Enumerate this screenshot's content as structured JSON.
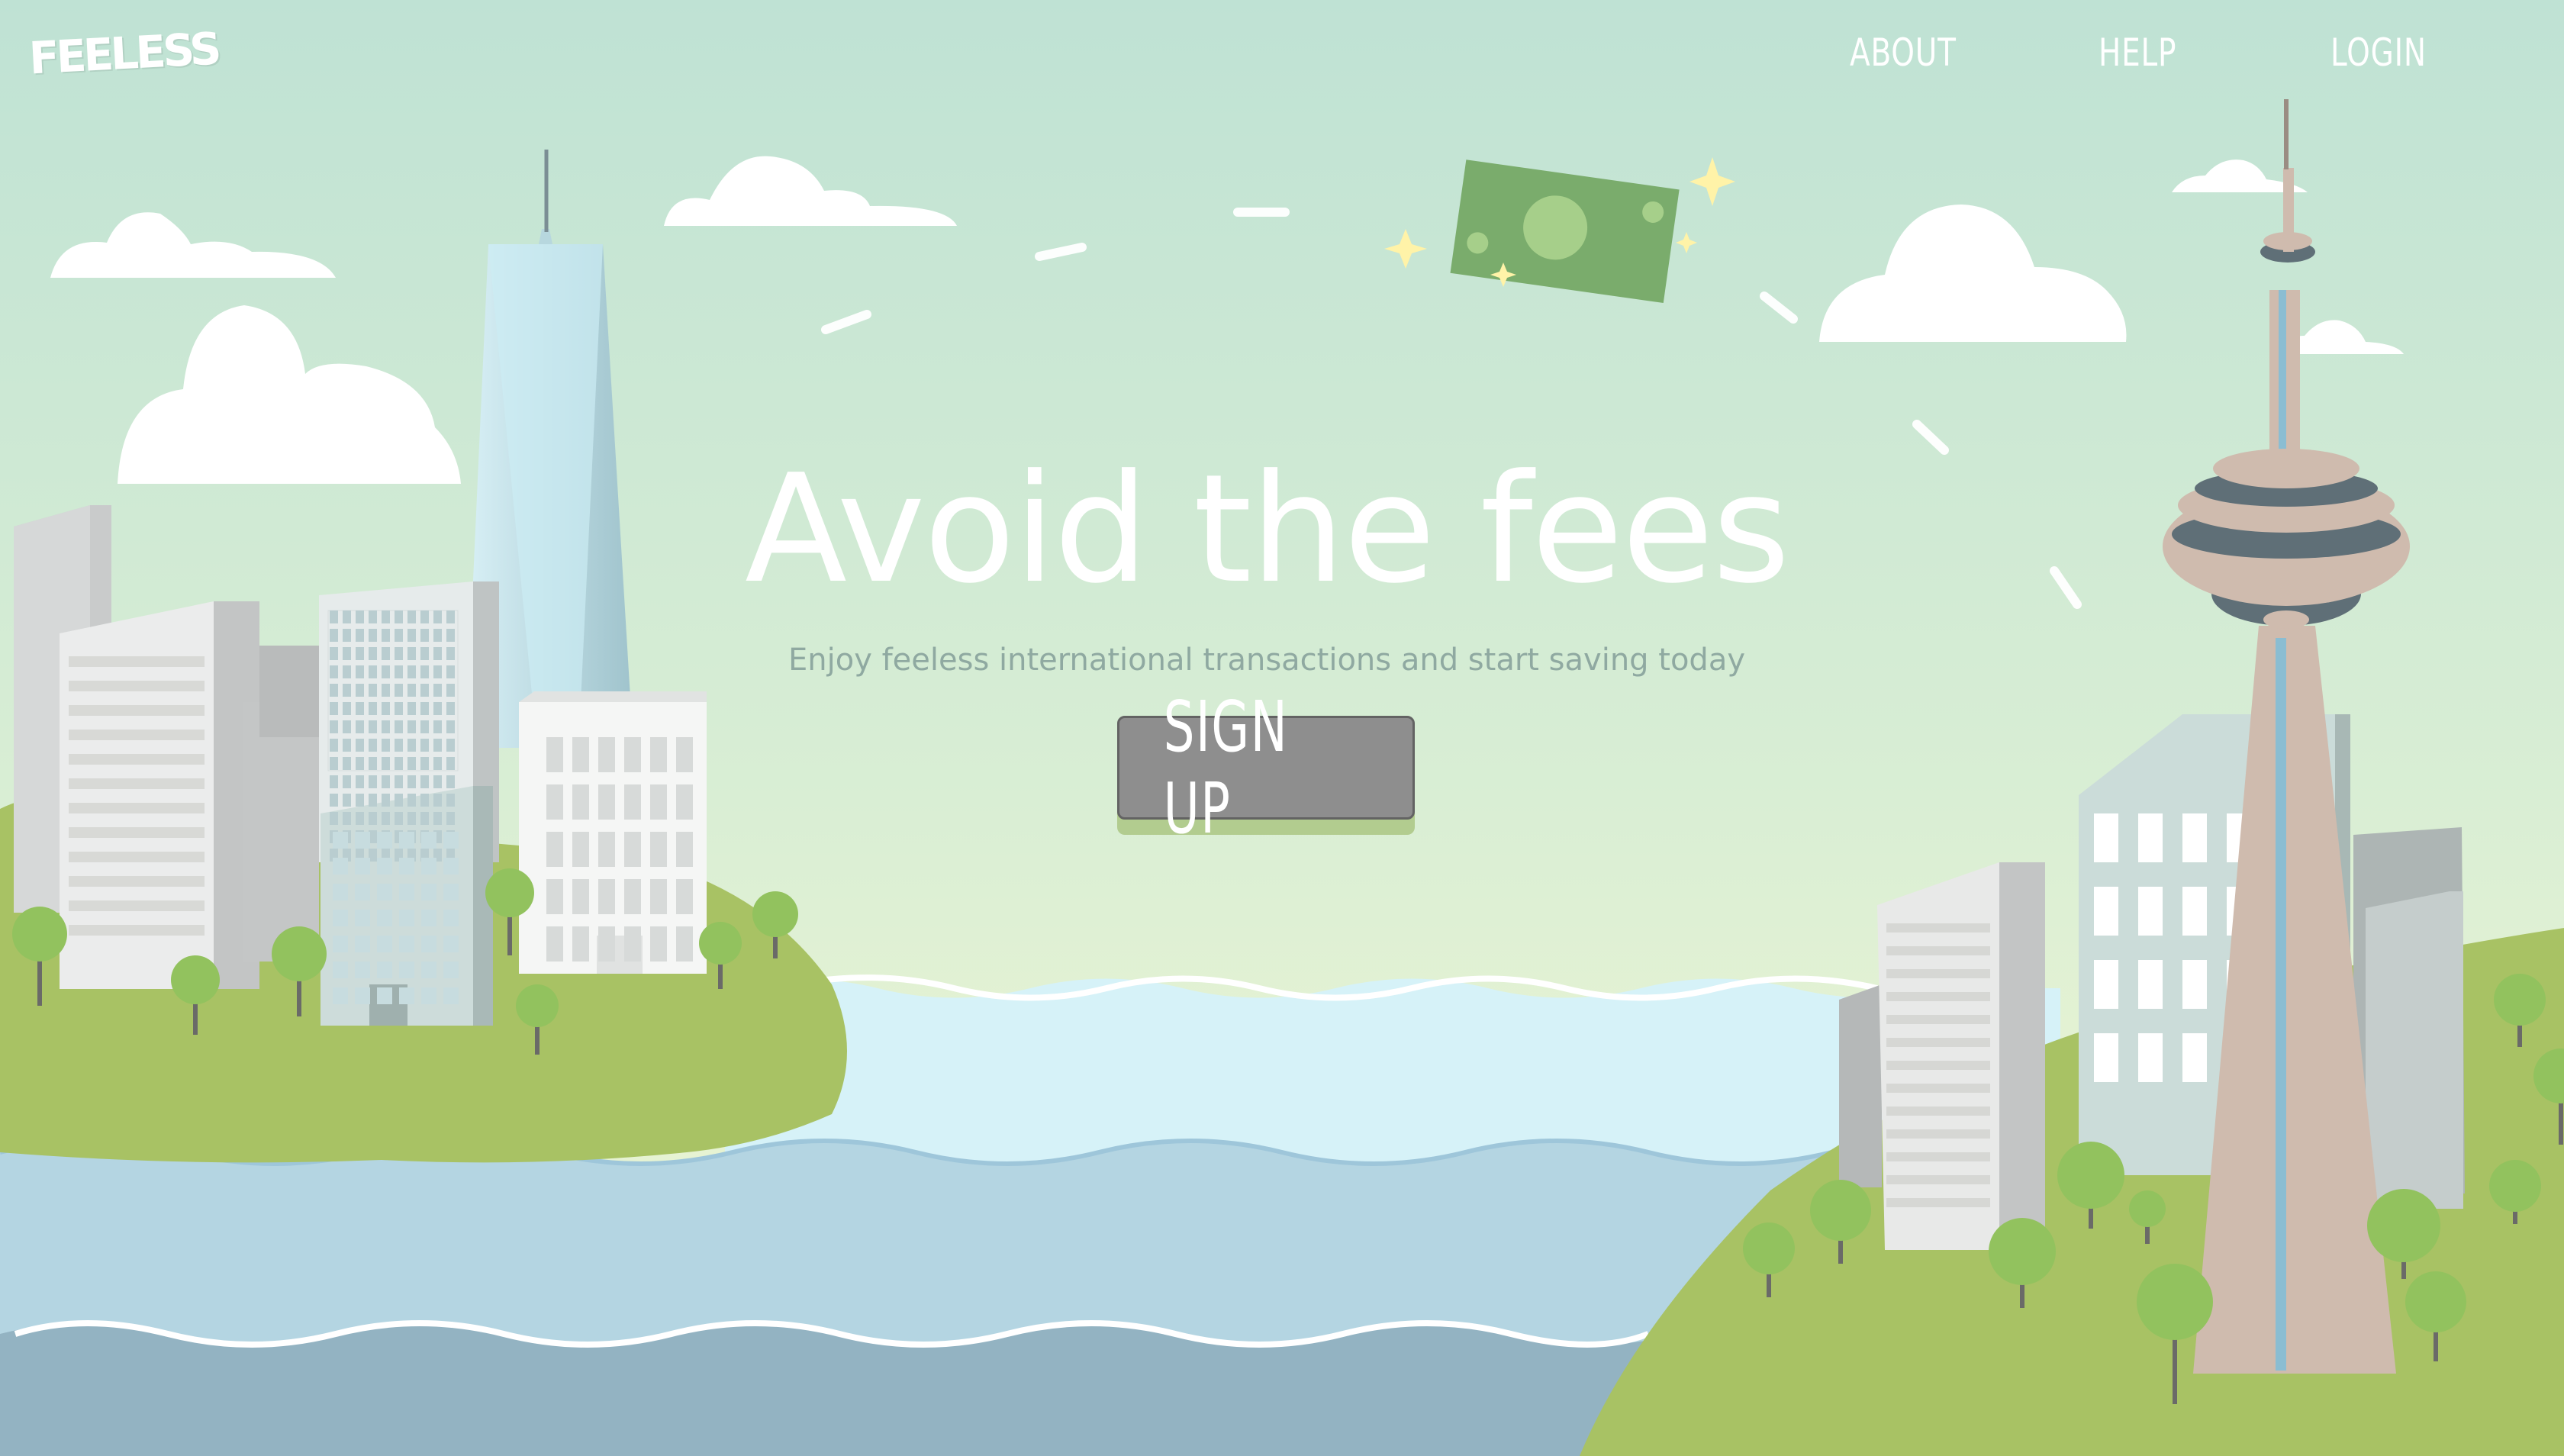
{
  "brand": {
    "logo_text": "FEELESS"
  },
  "nav": {
    "about_label": "ABOUT",
    "help_label": "HELP",
    "login_label": "LOGIN"
  },
  "hero": {
    "title": "Avoid the fees",
    "subtitle": "Enjoy feeless international transactions and start saving today",
    "signup_label": "SIGN UP"
  },
  "colors": {
    "sky_top": "#bfe2d4",
    "sky_bottom": "#e4f2d4",
    "ground": "#a8c264",
    "river_light": "#d6f2f8",
    "river_mid": "#b4d5e2",
    "river_dark": "#93b3c2",
    "button": "#8e8e8e",
    "money": "#7aac6c"
  },
  "icons": {
    "money": "banknote-icon",
    "sparkle": "sparkle-icon"
  }
}
